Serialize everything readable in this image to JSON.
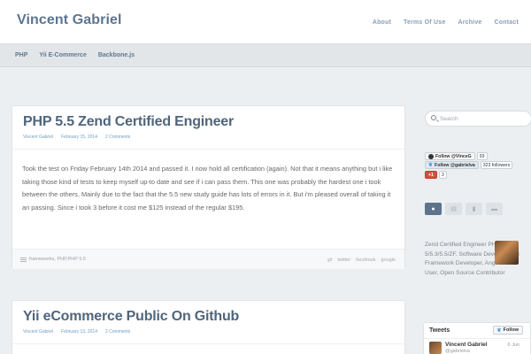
{
  "site": {
    "title": "Vincent Gabriel"
  },
  "top_nav": [
    "About",
    "Terms Of Use",
    "Archive",
    "Contact"
  ],
  "sub_nav": [
    "PHP",
    "Yii E-Commerce",
    "Backbone.js"
  ],
  "posts": [
    {
      "title": "PHP 5.5 Zend Certified Engineer",
      "author": "Vincent Gabriel",
      "date": "February 15, 2014",
      "comments": "2 Comments",
      "body": "Took the test on Friday February 14th 2014 and passed it. I now hold all certification (again). Not that it means anything but i like taking those kind of tests to keep myself up-to date and see if i can pass them. This one was probably the hardest one i took between the others, Mainly due to the fact that the 5.5 new study guide has lots of errors in it. But i'm pleased overall of taking it an passing. Since i took 3 before it cost me $125 instead of the regular $195.",
      "tags": "frameworks, PHP,PHP 5.5",
      "share": [
        "twitter",
        "facebook",
        "google"
      ]
    },
    {
      "title": "Yii eCommerce Public On Github",
      "author": "Vincent Gabriel",
      "date": "February 13, 2014",
      "comments": "2 Comments"
    }
  ],
  "sidebar": {
    "search_placeholder": "Search",
    "github_label": "Follow @VinceG",
    "github_count": "93",
    "twitter_label": "Follow @gabrielva",
    "twitter_count": "323 followers",
    "gplus_label": "+1",
    "gplus_count": "3",
    "about": "Zend Certified Engineer PHP 5/5.3/5.5/ZF. Software Developer, Yii Framework Developer, AngularJS User, Open Source Contributor",
    "tweets_title": "Tweets",
    "tweets_follow": "Follow",
    "tweet_name": "Vincent Gabriel",
    "tweet_handle": "@gabrielva",
    "tweet_date": "6 Jun"
  },
  "colors": {
    "accent": "#5d7590",
    "link": "#6e9ec3",
    "gplus": "#d44f3e"
  }
}
